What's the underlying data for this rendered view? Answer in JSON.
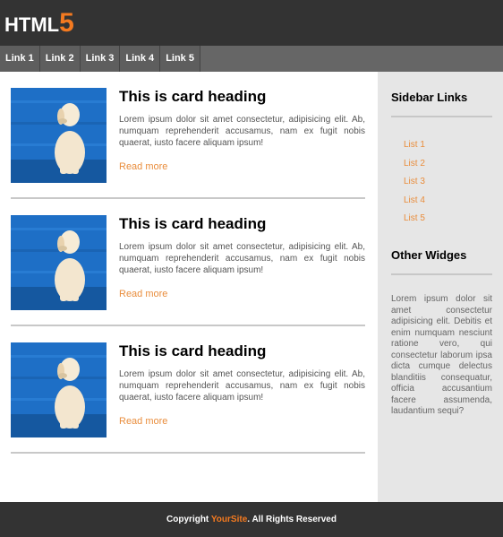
{
  "header": {
    "logo_text": "HTML",
    "logo_accent": "5"
  },
  "nav": {
    "links": [
      "Link 1",
      "Link 2",
      "Link 3",
      "Link 4",
      "Link 5"
    ]
  },
  "cards": [
    {
      "heading": "This is card heading",
      "text": "Lorem ipsum dolor sit amet consectetur, adipisicing elit. Ab, numquam reprehenderit accusamus, nam ex fugit nobis quaerat, iusto facere aliquam ipsum!",
      "link": "Read more"
    },
    {
      "heading": "This is card heading",
      "text": "Lorem ipsum dolor sit amet consectetur, adipisicing elit. Ab, numquam reprehenderit accusamus, nam ex fugit nobis quaerat, iusto facere aliquam ipsum!",
      "link": "Read more"
    },
    {
      "heading": "This is card heading",
      "text": "Lorem ipsum dolor sit amet consectetur, adipisicing elit. Ab, numquam reprehenderit accusamus, nam ex fugit nobis quaerat, iusto facere aliquam ipsum!",
      "link": "Read more"
    }
  ],
  "sidebar": {
    "links_title": "Sidebar Links",
    "links": [
      "List 1",
      "List 2",
      "List 3",
      "List 4",
      "List 5"
    ],
    "widgets_title": "Other Widges",
    "widgets_text": "Lorem ipsum dolor sit amet consectetur adipisicing elit. Debitis et enim numquam nesciunt ratione vero, qui consectetur laborum ipsa dicta cumque delectus blanditiis consequatur, officia accusantium facere assumenda, laudantium sequi?"
  },
  "footer": {
    "prefix": "Copyright ",
    "site": "YourSite",
    "suffix": ". All Rights Reserved"
  },
  "colors": {
    "accent": "#f47a20",
    "header_bg": "#333333",
    "nav_bg": "#666666",
    "sidebar_bg": "#e6e6e6"
  }
}
